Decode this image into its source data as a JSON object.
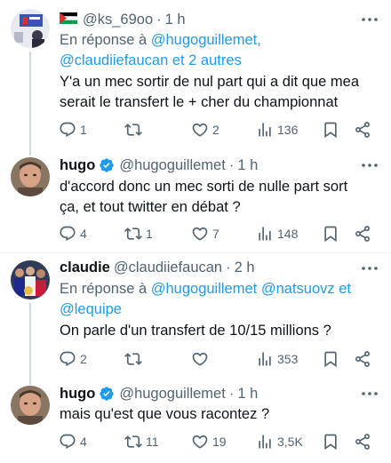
{
  "tweets": [
    {
      "flag_icon": "palestine-flag-icon",
      "name": "",
      "handle": "@ks_69oo",
      "dot": "·",
      "time": "1 h",
      "reply_prefix": "En réponse à",
      "reply_mentions_1": "@hugoguillemet,",
      "reply_mentions_2": "@claudiiefaucan et 2 autres",
      "text_line1": "Y'a un mec sortir de nul part qui a dit que mea",
      "text_line2": "serait le transfert le + cher du championnat",
      "replies": "1",
      "retweets": "",
      "likes": "2",
      "views": "136"
    },
    {
      "name": "hugo",
      "verified": true,
      "handle": "@hugoguillemet",
      "dot": "·",
      "time": "1 h",
      "text_line1": "d'accord donc un mec sorti de nulle part sort",
      "text_line2": "ça, et tout twitter en débat ?",
      "replies": "4",
      "retweets": "1",
      "likes": "7",
      "views": "148"
    },
    {
      "name": "claudie",
      "handle": "@claudiiefaucan",
      "dot": "·",
      "time": "2 h",
      "reply_prefix": "En réponse à",
      "reply_mention_a": "@hugoguillemet",
      "reply_mention_b": "@natsuovz",
      "reply_and": "et",
      "reply_mention_c": "@lequipe",
      "text_line1": "On parle d'un transfert de 10/15 millions ?",
      "replies": "2",
      "retweets": "",
      "likes": "",
      "views": "353"
    },
    {
      "name": "hugo",
      "verified": true,
      "handle": "@hugoguillemet",
      "dot": "·",
      "time": "1 h",
      "text_line1": "mais qu'est que vous racontez ?",
      "replies": "4",
      "retweets": "11",
      "likes": "19",
      "views": "3,5K"
    }
  ],
  "colors": {
    "link": "#1d9bf0",
    "secondary": "#536471",
    "verified": "#1d9bf0",
    "thread_line": "#cfd9de"
  }
}
